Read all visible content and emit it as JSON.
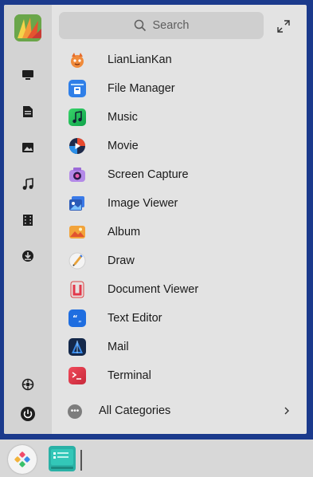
{
  "search": {
    "placeholder": "Search"
  },
  "sidebar": {
    "items": [
      {
        "icon": "computer-icon"
      },
      {
        "icon": "document-icon"
      },
      {
        "icon": "picture-icon"
      },
      {
        "icon": "music-icon"
      },
      {
        "icon": "video-icon"
      },
      {
        "icon": "download-icon"
      }
    ],
    "bottom": [
      {
        "icon": "settings-icon"
      },
      {
        "icon": "power-icon"
      }
    ]
  },
  "apps": [
    {
      "label": "LianLianKan",
      "icon": "lianliankan-icon"
    },
    {
      "label": "File Manager",
      "icon": "file-manager-icon"
    },
    {
      "label": "Music",
      "icon": "music-app-icon"
    },
    {
      "label": "Movie",
      "icon": "movie-icon"
    },
    {
      "label": "Screen Capture",
      "icon": "screen-capture-icon"
    },
    {
      "label": "Image Viewer",
      "icon": "image-viewer-icon"
    },
    {
      "label": "Album",
      "icon": "album-icon"
    },
    {
      "label": "Draw",
      "icon": "draw-icon"
    },
    {
      "label": "Document Viewer",
      "icon": "document-viewer-icon"
    },
    {
      "label": "Text Editor",
      "icon": "text-editor-icon"
    },
    {
      "label": "Mail",
      "icon": "mail-icon"
    },
    {
      "label": "Terminal",
      "icon": "terminal-icon"
    }
  ],
  "categories": {
    "label": "All Categories",
    "icon": "more-icon",
    "dots": "•••"
  },
  "colors": {
    "launcher_bg": "#e3e3e3",
    "sidebar_bg": "#d3d3d3",
    "desktop_bg": "#1b3a8c",
    "taskbar_bg": "#d8d8d8"
  }
}
